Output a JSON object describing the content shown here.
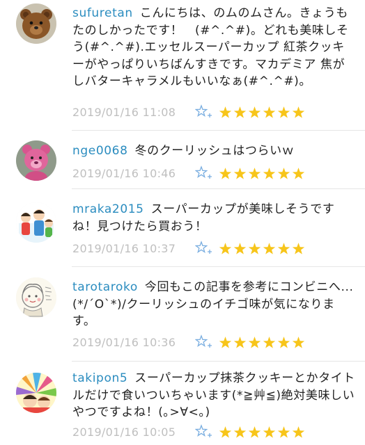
{
  "comments": [
    {
      "username": "sufuretan",
      "text": "こんにちは、のムのムさん。きょうもたのしかったです！　(#^.^#)。どれも美味しそう(#^.^#).エッセルスーパーカップ 紅茶クッキーがやっぱりいちばんすきです。マカデミア 焦がしバターキャラメルもいいなぁ(#^.^#)。",
      "timestamp": "2019/01/16 11:08",
      "avatar_icon": "teddy-bear-icon",
      "stars": 6
    },
    {
      "username": "nge0068",
      "text": "冬のクーリッシュはつらいｗ",
      "timestamp": "2019/01/16 10:46",
      "avatar_icon": "pink-bear-icon",
      "stars": 6
    },
    {
      "username": "mraka2015",
      "text": "スーパーカップが美味しそうですね！見つけたら買おう！",
      "timestamp": "2019/01/16 10:37",
      "avatar_icon": "family-illustration-icon",
      "stars": 6
    },
    {
      "username": "tarotaroko",
      "text": "今回もこの記事を参考にコンビニへ...(*/´O`*)/クーリッシュのイチゴ味が気になります。",
      "timestamp": "2019/01/16 10:36",
      "avatar_icon": "child-drawing-icon",
      "stars": 6
    },
    {
      "username": "takipon5",
      "text": "スーパーカップ抹茶クッキーとかタイトルだけで食いついちゃいます(*≧艸≦)絶対美味しいやつですよね！(｡>∀<｡)",
      "timestamp": "2019/01/16 10:05",
      "avatar_icon": "colorful-illustration-icon",
      "stars": 6
    }
  ],
  "colors": {
    "username": "#2a8cbf",
    "timestamp": "#bfbfbf",
    "star": "#f7c51a",
    "fav_outline": "#7aaee0",
    "divider": "#e6e6e6"
  }
}
